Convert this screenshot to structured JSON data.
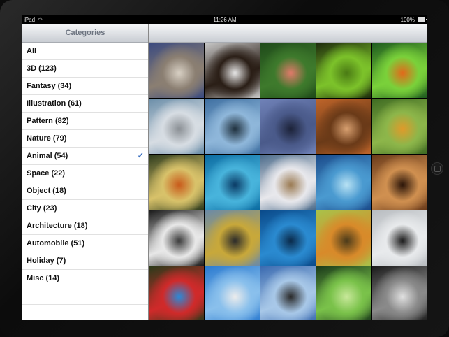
{
  "status": {
    "carrier": "iPad",
    "time": "11:26 AM",
    "battery": "100%"
  },
  "sidebar": {
    "title": "Categories",
    "items": [
      {
        "label": "All"
      },
      {
        "label": "3D (123)"
      },
      {
        "label": "Fantasy (34)"
      },
      {
        "label": "Illustration (61)"
      },
      {
        "label": "Pattern (82)"
      },
      {
        "label": "Nature (79)"
      },
      {
        "label": "Animal (54)",
        "selected": true
      },
      {
        "label": "Space (22)"
      },
      {
        "label": "Object (18)"
      },
      {
        "label": "City (23)"
      },
      {
        "label": "Architecture (18)"
      },
      {
        "label": "Automobile (51)"
      },
      {
        "label": "Holiday (7)"
      },
      {
        "label": "Misc (14)"
      }
    ],
    "check_glyph": "✓"
  },
  "grid": {
    "thumbnails": [
      {
        "name": "kitten-photo",
        "colors": [
          "#3a4a80",
          "#8b7f72",
          "#d8d0c4"
        ]
      },
      {
        "name": "puppy-fence-photo",
        "colors": [
          "#c9c9c9",
          "#2a1e16",
          "#e8e8e8"
        ]
      },
      {
        "name": "flamingos-photo",
        "colors": [
          "#1f4a1a",
          "#3e7a2c",
          "#e07a6a"
        ]
      },
      {
        "name": "green-snake-photo",
        "colors": [
          "#1d2a0c",
          "#7cc22a",
          "#4a7a14"
        ]
      },
      {
        "name": "clownfish-anemone-photo",
        "colors": [
          "#1d5a1e",
          "#7ad13a",
          "#e3681a"
        ]
      },
      {
        "name": "snow-leopard-photo",
        "colors": [
          "#6a8da8",
          "#d7dde3",
          "#8a8f94"
        ]
      },
      {
        "name": "duck-lake-photo",
        "colors": [
          "#3d6ea0",
          "#8fb7da",
          "#1e2f3c"
        ]
      },
      {
        "name": "sea-lion-photo",
        "colors": [
          "#7082b8",
          "#4a5a8a",
          "#1c2238"
        ]
      },
      {
        "name": "cat-guitar-photo",
        "colors": [
          "#c0652a",
          "#6a3a18",
          "#d8a070"
        ]
      },
      {
        "name": "butterfly-flowers-photo",
        "colors": [
          "#3e6a22",
          "#8db64a",
          "#e09a2a"
        ]
      },
      {
        "name": "butterfly-blossoms-photo",
        "colors": [
          "#2c3a1c",
          "#d8c26a",
          "#c85a1a"
        ]
      },
      {
        "name": "underwater-fish-photo",
        "colors": [
          "#0a6aa0",
          "#48b4dc",
          "#0a3a64"
        ]
      },
      {
        "name": "cougar-snow-photo",
        "colors": [
          "#4a6a8a",
          "#e8e8ec",
          "#9a7a52"
        ]
      },
      {
        "name": "dolphins-photo",
        "colors": [
          "#1a4a8a",
          "#4a9ad0",
          "#b8e2f4"
        ]
      },
      {
        "name": "sleeping-puppy-photo",
        "colors": [
          "#6a3a1a",
          "#d09050",
          "#2a1408"
        ]
      },
      {
        "name": "black-white-cat-photo",
        "colors": [
          "#1a1a1a",
          "#e8e8e8",
          "#3a3a3a"
        ]
      },
      {
        "name": "yellow-bird-photo",
        "colors": [
          "#6a8aa8",
          "#c8a83a",
          "#2a2a2a"
        ]
      },
      {
        "name": "whale-ocean-photo",
        "colors": [
          "#0a4a8a",
          "#2a8ad0",
          "#0a2a4a"
        ]
      },
      {
        "name": "butterfly-macro-photo",
        "colors": [
          "#a8c24a",
          "#d88a2a",
          "#4a3a1a"
        ]
      },
      {
        "name": "bird-post-photo",
        "colors": [
          "#b8bcc0",
          "#e8eaec",
          "#1a1a1a"
        ]
      },
      {
        "name": "macaw-parrot-photo",
        "colors": [
          "#2a3a1a",
          "#d02a2a",
          "#2a8ad8"
        ]
      },
      {
        "name": "seal-pup-photo",
        "colors": [
          "#2a7ad0",
          "#8ac0ec",
          "#ececec"
        ]
      },
      {
        "name": "seabird-flying-photo",
        "colors": [
          "#3a6ab0",
          "#a8c8e8",
          "#2a2a2a"
        ]
      },
      {
        "name": "budgies-photo",
        "colors": [
          "#1a3a1a",
          "#7ac24a",
          "#c8e89a"
        ]
      },
      {
        "name": "wolf-photo",
        "colors": [
          "#1a1a1a",
          "#8a8a8a",
          "#e0e0e0"
        ]
      }
    ]
  }
}
